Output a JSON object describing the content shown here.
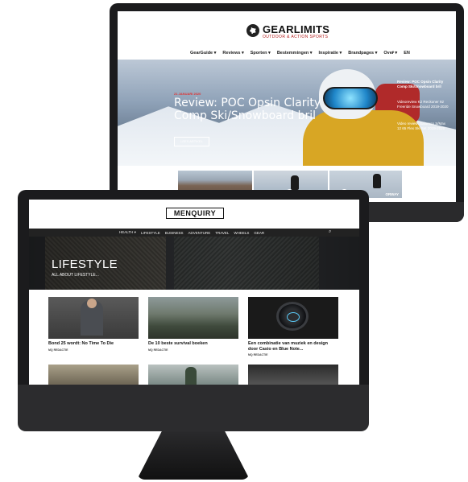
{
  "gearlimits": {
    "brand": "GEARLIMITS",
    "tagline": "OUTDOOR & ACTION SPORTS",
    "nav": [
      "GearGuide ▾",
      "Reviews ▾",
      "Sporten ▾",
      "Bestemmingen ▾",
      "Inspiratie ▾",
      "Brandpages ▾",
      "Over ▾",
      "EN"
    ],
    "hero": {
      "date": "21 JANUARI 2020",
      "title": "Review: POC Opsin Clarity Comp Ski/Snowboard bril",
      "button": "LEES ARTIKEL"
    },
    "side_items": [
      "Review: POC Opsin Clarity Comp Ski/Snowboard bril",
      "Videoreview K2 Reckoner 92 Freeride Snowboard 2019-2020",
      "Video review: Salomon S/Max 12 65 Flex Ski Set 2019-2020"
    ],
    "thumb_label": "ORWAY"
  },
  "menquiry": {
    "brand": "MENQUIRY",
    "nav": [
      "HEALTH ▾",
      "LIFESTYLE",
      "BUSINESS",
      "ADVENTURE",
      "TRAVEL",
      "WHEELS",
      "GEAR"
    ],
    "hero": {
      "title": "LIFESTYLE",
      "subtitle": "ALL ABOUT LIFESTYLE..."
    },
    "cards": [
      {
        "title": "Bond 25 wordt: No Time To Die",
        "category": "MQ REDACTIE"
      },
      {
        "title": "De 10 beste survival boeken",
        "category": "MQ REDACTIE"
      },
      {
        "title": "Een combinatie van muziek en design door Casio en Blue Note...",
        "category": "MQ REDACTIE"
      }
    ]
  },
  "icons": {
    "search": "search-icon",
    "apple": "apple-logo-icon",
    "play": "play-icon"
  }
}
